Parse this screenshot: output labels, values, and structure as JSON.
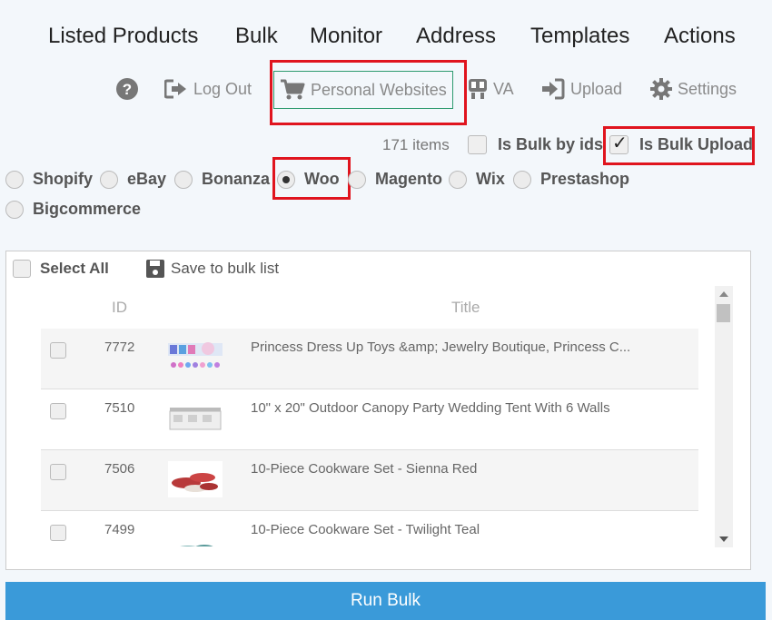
{
  "nav": {
    "items": [
      {
        "label": "Listed Products"
      },
      {
        "label": "Bulk"
      },
      {
        "label": "Monitor"
      },
      {
        "label": "Address"
      },
      {
        "label": "Templates"
      },
      {
        "label": "Actions"
      }
    ]
  },
  "toolbar": {
    "help_icon": "question-circle-icon",
    "logout": {
      "label": "Log Out",
      "icon": "sign-out-icon"
    },
    "personal_websites": {
      "label": "Personal Websites",
      "icon": "shopping-cart-icon"
    },
    "va": {
      "label": "VA",
      "icon": "va-icon"
    },
    "upload": {
      "label": "Upload",
      "icon": "sign-in-icon"
    },
    "settings": {
      "label": "Settings",
      "icon": "gear-icon"
    }
  },
  "filters": {
    "items_count": "171 items",
    "is_bulk_by_ids": {
      "label": "Is Bulk by ids",
      "checked": false
    },
    "is_bulk_upload": {
      "label": "Is Bulk Upload",
      "checked": true
    }
  },
  "platforms": {
    "selected": "Woo",
    "options": [
      {
        "label": "Shopify"
      },
      {
        "label": "eBay"
      },
      {
        "label": "Bonanza"
      },
      {
        "label": "Woo"
      },
      {
        "label": "Magento"
      },
      {
        "label": "Wix"
      },
      {
        "label": "Prestashop"
      },
      {
        "label": "Bigcommerce"
      }
    ]
  },
  "table": {
    "select_all": "Select All",
    "save_to_bulk": "Save to bulk list",
    "columns": {
      "id": "ID",
      "title": "Title"
    },
    "rows": [
      {
        "id": "7772",
        "title": "Princess Dress Up Toys &amp; Jewelry Boutique, Princess C..."
      },
      {
        "id": "7510",
        "title": "10\" x 20\" Outdoor Canopy Party Wedding Tent With 6 Walls"
      },
      {
        "id": "7506",
        "title": "10-Piece Cookware Set - Sienna Red"
      },
      {
        "id": "7499",
        "title": "10-Piece Cookware Set - Twilight Teal"
      }
    ]
  },
  "run_bulk": "Run Bulk",
  "colors": {
    "accent": "#3a9ad9",
    "highlight": "#e0141e",
    "personal_websites_border": "#2e9b6f"
  }
}
